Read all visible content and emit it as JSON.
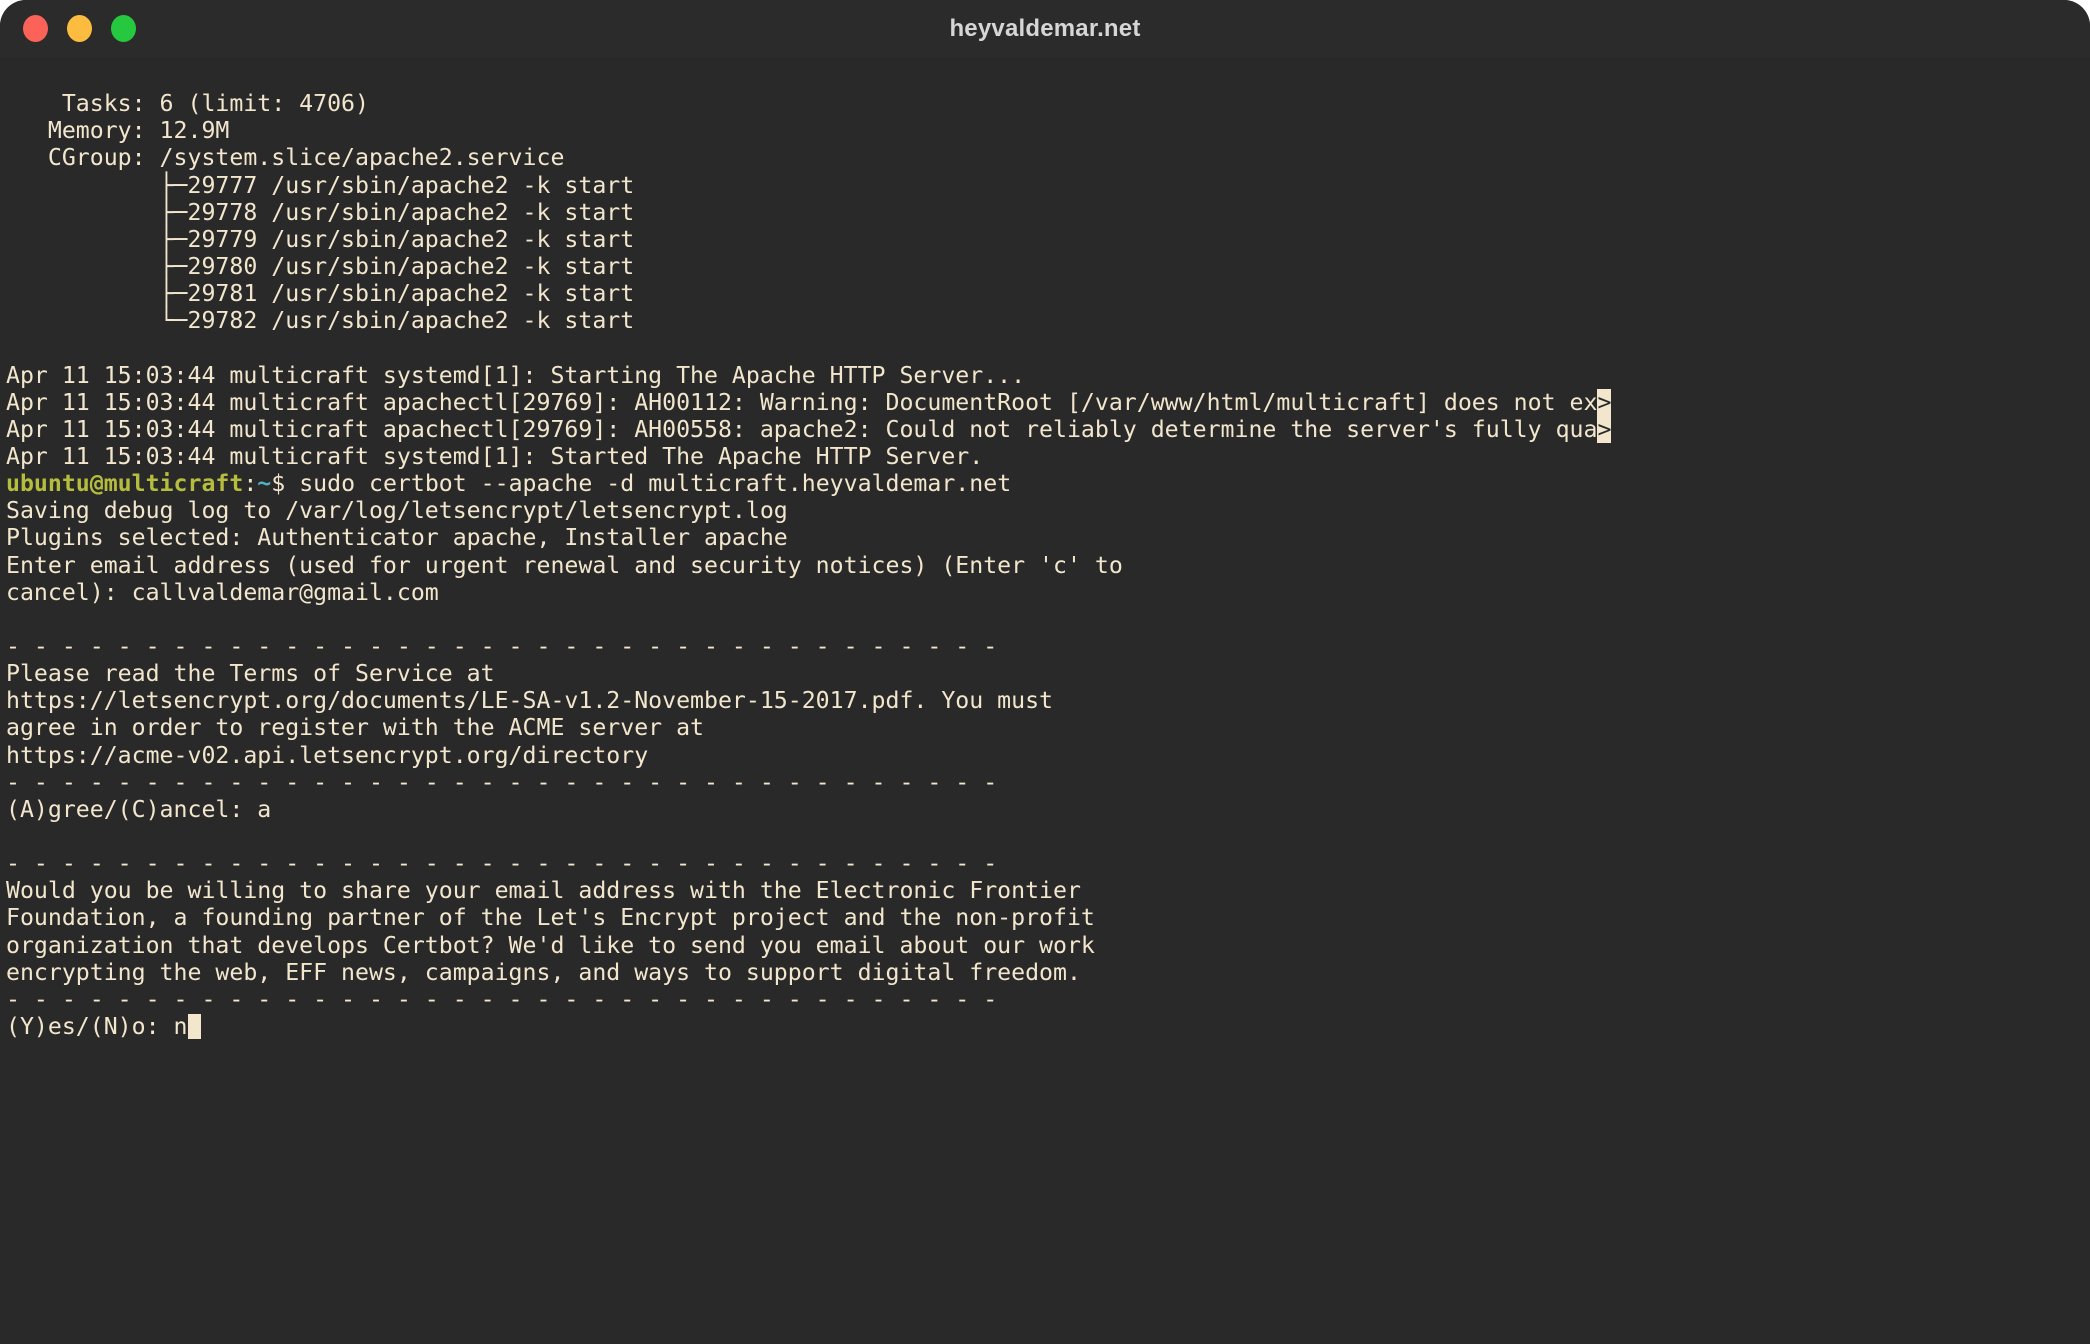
{
  "window": {
    "title": "heyvaldemar.net",
    "controls": [
      {
        "name": "close",
        "color": "#fb6258"
      },
      {
        "name": "minimize",
        "color": "#fcbc40"
      },
      {
        "name": "maximize",
        "color": "#26c83f"
      }
    ],
    "background": "#292929",
    "foreground": "#f2e6cd"
  },
  "terminal": {
    "colors": {
      "bg": "#292929",
      "fg": "#f2e6cd",
      "user": "#b5bd3f",
      "path": "#4fb3bf",
      "cursor": "#f2e6cd"
    },
    "separator": "- - - - - - - - - - - - - - - - - - - - - - - - - - - - - - - - - - - -",
    "lines": [
      {
        "id": "l01",
        "text": ""
      },
      {
        "id": "l02",
        "text": "    Tasks: 6 (limit: 4706)"
      },
      {
        "id": "l03",
        "text": "   Memory: 12.9M"
      },
      {
        "id": "l04",
        "text": "   CGroup: /system.slice/apache2.service"
      },
      {
        "id": "l05",
        "text": "           ├─29777 /usr/sbin/apache2 -k start"
      },
      {
        "id": "l06",
        "text": "           ├─29778 /usr/sbin/apache2 -k start"
      },
      {
        "id": "l07",
        "text": "           ├─29779 /usr/sbin/apache2 -k start"
      },
      {
        "id": "l08",
        "text": "           ├─29780 /usr/sbin/apache2 -k start"
      },
      {
        "id": "l09",
        "text": "           ├─29781 /usr/sbin/apache2 -k start"
      },
      {
        "id": "l10",
        "text": "           └─29782 /usr/sbin/apache2 -k start"
      },
      {
        "id": "l11",
        "text": ""
      },
      {
        "id": "l12",
        "text": "Apr 11 15:03:44 multicraft systemd[1]: Starting The Apache HTTP Server..."
      },
      {
        "id": "l13",
        "text": "Apr 11 15:03:44 multicraft apachectl[29769]: AH00112: Warning: DocumentRoot [/var/www/html/multicraft] does not ex",
        "overflow": ">"
      },
      {
        "id": "l14",
        "text": "Apr 11 15:03:44 multicraft apachectl[29769]: AH00558: apache2: Could not reliably determine the server's fully qua",
        "overflow": ">"
      },
      {
        "id": "l15",
        "text": "Apr 11 15:03:44 multicraft systemd[1]: Started The Apache HTTP Server."
      }
    ],
    "prompt": {
      "user_host": "ubuntu@multicraft",
      "colon": ":",
      "cwd": "~",
      "sigil": "$ ",
      "command": "sudo certbot --apache -d multicraft.heyvaldemar.net"
    },
    "certbot": [
      {
        "id": "c01",
        "text": "Saving debug log to /var/log/letsencrypt/letsencrypt.log"
      },
      {
        "id": "c02",
        "text": "Plugins selected: Authenticator apache, Installer apache"
      },
      {
        "id": "c03",
        "text": "Enter email address (used for urgent renewal and security notices) (Enter 'c' to"
      },
      {
        "id": "c04",
        "text": "cancel): callvaldemar@gmail.com"
      },
      {
        "id": "c05",
        "text": ""
      },
      {
        "id": "c06",
        "text": "__SEPARATOR__"
      },
      {
        "id": "c07",
        "text": "Please read the Terms of Service at"
      },
      {
        "id": "c08",
        "text": "https://letsencrypt.org/documents/LE-SA-v1.2-November-15-2017.pdf. You must"
      },
      {
        "id": "c09",
        "text": "agree in order to register with the ACME server at"
      },
      {
        "id": "c10",
        "text": "https://acme-v02.api.letsencrypt.org/directory"
      },
      {
        "id": "c11",
        "text": "__SEPARATOR__"
      },
      {
        "id": "c12",
        "text": "(A)gree/(C)ancel: a"
      },
      {
        "id": "c13",
        "text": ""
      },
      {
        "id": "c14",
        "text": "__SEPARATOR__"
      },
      {
        "id": "c15",
        "text": "Would you be willing to share your email address with the Electronic Frontier"
      },
      {
        "id": "c16",
        "text": "Foundation, a founding partner of the Let's Encrypt project and the non-profit"
      },
      {
        "id": "c17",
        "text": "organization that develops Certbot? We'd like to send you email about our work"
      },
      {
        "id": "c18",
        "text": "encrypting the web, EFF news, campaigns, and ways to support digital freedom."
      },
      {
        "id": "c19",
        "text": "__SEPARATOR__"
      }
    ],
    "final_prompt": {
      "label": "(Y)es/(N)o: ",
      "typed": "n"
    }
  }
}
